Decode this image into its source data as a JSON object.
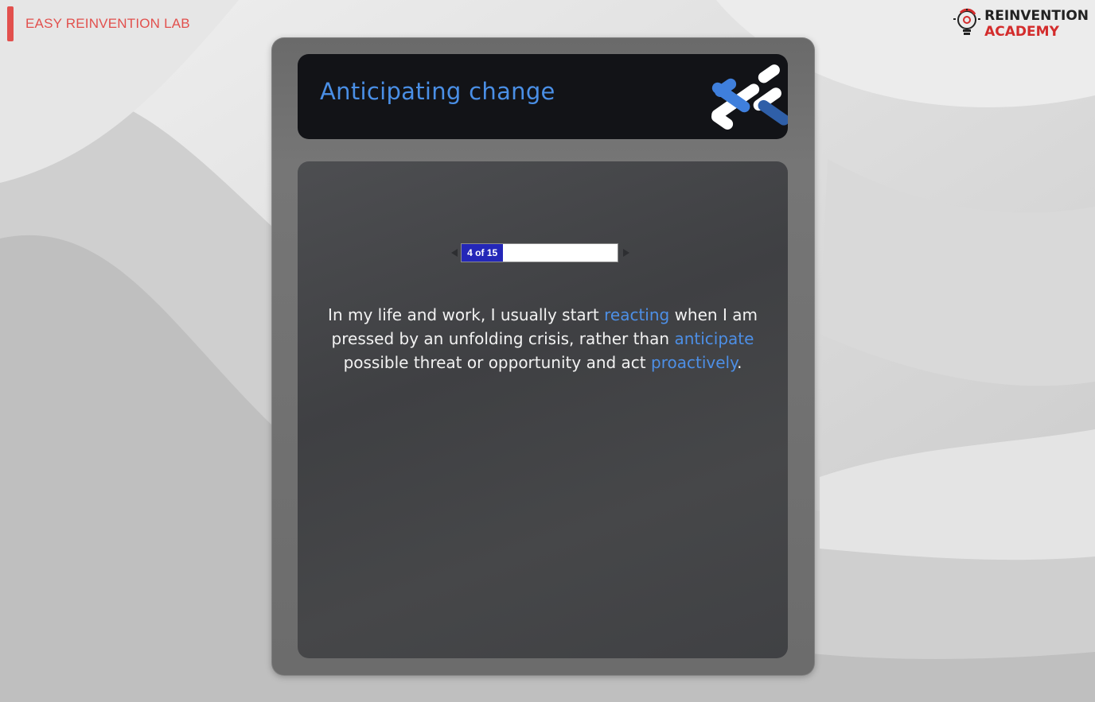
{
  "brand": {
    "lab_name": "EASY REINVENTION LAB",
    "academy_line1": "REINVENTION",
    "academy_line2": "ACADEMY",
    "logo_icon": "lightbulb-gear-icon",
    "accent_color": "#e2504d"
  },
  "card": {
    "title": "Anticipating change",
    "title_color": "#4a8fe6"
  },
  "pager": {
    "label": "4 of 15",
    "current": 4,
    "total": 15,
    "progress_percent": 26.7,
    "fill_color": "#2427b8"
  },
  "question": {
    "part1": "In my life and work, I usually start ",
    "keyword1": "reacting",
    "part2": " when I am pressed by an unfolding crisis, rather than ",
    "keyword2": "anticipate",
    "part3": " possible threat or opportunity and act ",
    "keyword3": "proactively",
    "part4": "."
  }
}
